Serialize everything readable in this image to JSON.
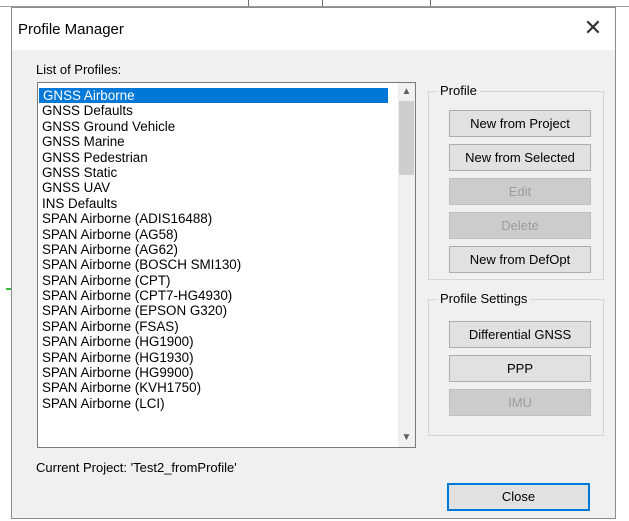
{
  "window": {
    "title": "Profile Manager",
    "close_glyph": "✕"
  },
  "list": {
    "label": "List of Profiles:",
    "selected_index": 0,
    "items": [
      "GNSS Airborne",
      "GNSS Defaults",
      "GNSS Ground Vehicle",
      "GNSS Marine",
      "GNSS Pedestrian",
      "GNSS Static",
      "GNSS UAV",
      "INS Defaults",
      "SPAN Airborne (ADIS16488)",
      "SPAN Airborne (AG58)",
      "SPAN Airborne (AG62)",
      "SPAN Airborne (BOSCH SMI130)",
      "SPAN Airborne (CPT)",
      "SPAN Airborne (CPT7-HG4930)",
      "SPAN Airborne (EPSON G320)",
      "SPAN Airborne (FSAS)",
      "SPAN Airborne (HG1900)",
      "SPAN Airborne (HG1930)",
      "SPAN Airborne (HG9900)",
      "SPAN Airborne (KVH1750)",
      "SPAN Airborne (LCI)"
    ],
    "scroll_up_glyph": "▲",
    "scroll_down_glyph": "▼"
  },
  "profile_group": {
    "title": "Profile",
    "buttons": {
      "new_from_project": "New from Project",
      "new_from_selected": "New from Selected",
      "edit": "Edit",
      "delete": "Delete",
      "new_from_defopt": "New from DefOpt"
    }
  },
  "settings_group": {
    "title": "Profile Settings",
    "buttons": {
      "differential_gnss": "Differential GNSS",
      "ppp": "PPP",
      "imu": "IMU"
    }
  },
  "status": {
    "current_project": "Current Project: 'Test2_fromProfile'"
  },
  "footer": {
    "close_label": "Close"
  },
  "colors": {
    "selection": "#0078d7",
    "dialog_bg": "#f0f0f0",
    "disabled_text": "#9b9b9b"
  }
}
